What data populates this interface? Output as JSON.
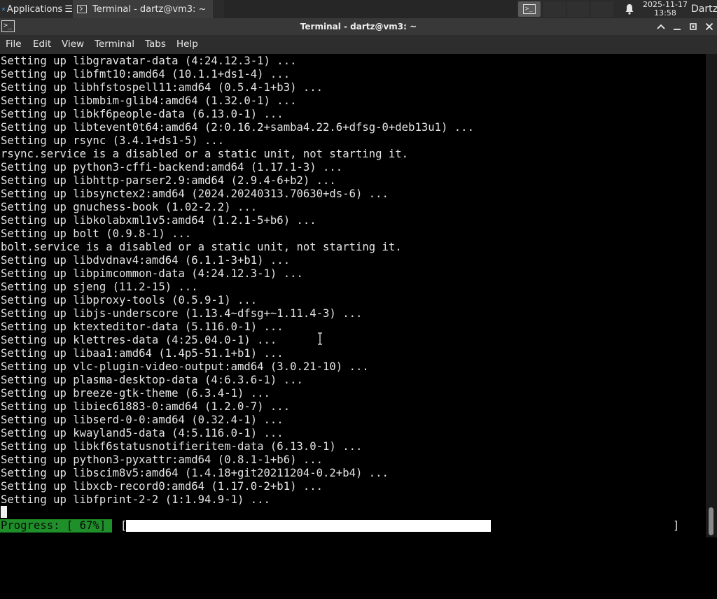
{
  "panel": {
    "apps_label": "Applications",
    "task_label": "Terminal - dartz@vm3: ~",
    "clock_date": "2025-11-17",
    "clock_time": "13:58",
    "user": "Dartz"
  },
  "window": {
    "title": "Terminal - dartz@vm3: ~",
    "menu": [
      "File",
      "Edit",
      "View",
      "Terminal",
      "Tabs",
      "Help"
    ]
  },
  "terminal": {
    "lines": [
      "Setting up libgravatar-data (4:24.12.3-1) ...",
      "Setting up libfmt10:amd64 (10.1.1+ds1-4) ...",
      "Setting up libhfstospell11:amd64 (0.5.4-1+b3) ...",
      "Setting up libmbim-glib4:amd64 (1.32.0-1) ...",
      "Setting up libkf6people-data (6.13.0-1) ...",
      "Setting up libtevent0t64:amd64 (2:0.16.2+samba4.22.6+dfsg-0+deb13u1) ...",
      "Setting up rsync (3.4.1+ds1-5) ...",
      "rsync.service is a disabled or a static unit, not starting it.",
      "Setting up python3-cffi-backend:amd64 (1.17.1-3) ...",
      "Setting up libhttp-parser2.9:amd64 (2.9.4-6+b2) ...",
      "Setting up libsynctex2:amd64 (2024.20240313.70630+ds-6) ...",
      "Setting up gnuchess-book (1.02-2.2) ...",
      "Setting up libkolabxml1v5:amd64 (1.2.1-5+b6) ...",
      "Setting up bolt (0.9.8-1) ...",
      "bolt.service is a disabled or a static unit, not starting it.",
      "Setting up libdvdnav4:amd64 (6.1.1-3+b1) ...",
      "Setting up libpimcommon-data (4:24.12.3-1) ...",
      "Setting up sjeng (11.2-15) ...",
      "Setting up libproxy-tools (0.5.9-1) ...",
      "Setting up libjs-underscore (1.13.4~dfsg+~1.11.4-3) ...",
      "Setting up ktexteditor-data (5.116.0-1) ...",
      "Setting up klettres-data (4:25.04.0-1) ...",
      "Setting up libaa1:amd64 (1.4p5-51.1+b1) ...",
      "Setting up vlc-plugin-video-output:amd64 (3.0.21-10) ...",
      "Setting up plasma-desktop-data (4:6.3.6-1) ...",
      "Setting up breeze-gtk-theme (6.3.4-1) ...",
      "Setting up libiec61883-0:amd64 (1.2.0-7) ...",
      "Setting up libserd-0-0:amd64 (0.32.4-1) ...",
      "Setting up kwayland5-data (4:5.116.0-1) ...",
      "Setting up libkf6statusnotifieritem-data (6.13.0-1) ...",
      "Setting up python3-pyxattr:amd64 (0.8.1-1+b6) ...",
      "Setting up libscim8v5:amd64 (1.4.18+git20211204-0.2+b4) ...",
      "Setting up libxcb-record0:amd64 (1.17.0-2+b1) ...",
      "Setting up libfprint-2-2 (1:1.94.9-1) ..."
    ],
    "progress_label": "Progress: [ 67%]",
    "progress_fraction": 0.67,
    "bracket_open": "[",
    "bracket_close": "]"
  },
  "colors": {
    "progress_green": "#1f8f2a",
    "terminal_bg": "#000000",
    "terminal_fg": "#e4e4e4"
  },
  "icons": [
    "xfce-mouse-icon",
    "terminal-icon",
    "bell-icon",
    "maximize-icon",
    "minimize-icon",
    "restore-icon",
    "close-icon",
    "ibeam-cursor-icon"
  ]
}
